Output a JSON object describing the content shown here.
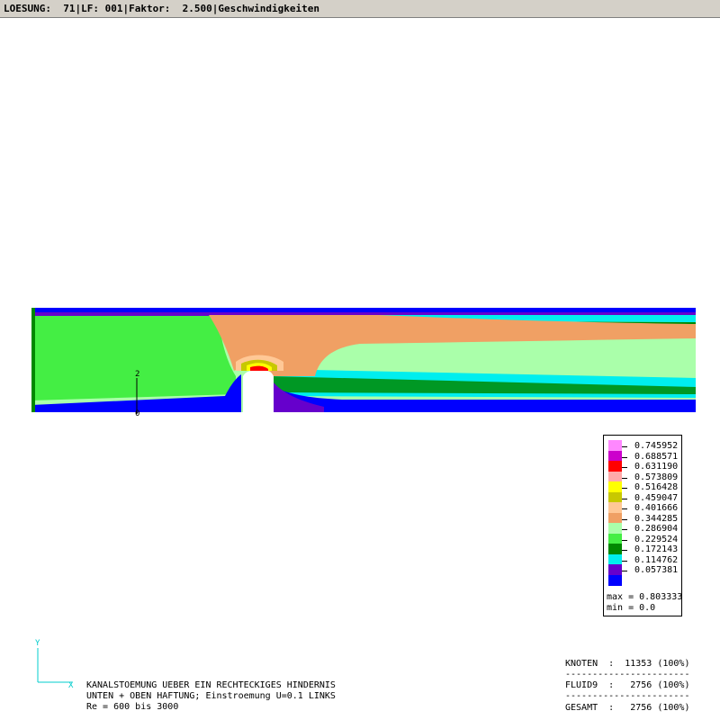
{
  "titlebar": {
    "text": "LOESUNG:  71|LF: 001|Faktor:  2.500|Geschwindigkeiten"
  },
  "legend": {
    "levels": [
      {
        "label": "0.745952",
        "color": "#ff88ff"
      },
      {
        "label": "0.688571",
        "color": "#cc00cc"
      },
      {
        "label": "0.631190",
        "color": "#ff0000"
      },
      {
        "label": "0.573809",
        "color": "#ffaaaa"
      },
      {
        "label": "0.516428",
        "color": "#ffff00"
      },
      {
        "label": "0.459047",
        "color": "#c8c800"
      },
      {
        "label": "0.401666",
        "color": "#ffc896"
      },
      {
        "label": "0.344285",
        "color": "#f0a064"
      },
      {
        "label": "0.286904",
        "color": "#aaffaa"
      },
      {
        "label": "0.229524",
        "color": "#44ee44"
      },
      {
        "label": "0.172143",
        "color": "#008800"
      },
      {
        "label": "0.114762",
        "color": "#00eeee"
      },
      {
        "label": "0.057381",
        "color": "#6600cc"
      },
      {
        "label": "",
        "color": "#0000ff"
      }
    ],
    "max_text": "max = 0.803333",
    "min_text": "min = 0.0"
  },
  "axis": {
    "y_letter": "Y",
    "x_letter": "X",
    "node_label_2": "2",
    "node_label_0": "0"
  },
  "caption": {
    "line1": "KANALSTOEMUNG UEBER EIN RECHTECKIGES HINDERNIS",
    "line2": "UNTEN + OBEN HAFTUNG; Einstroemung U=0.1 LINKS",
    "line3": "Re = 600 bis 3000"
  },
  "stats": {
    "knoten": "KNOTEN  :  11353 (100%)",
    "fluid9": "FLUID9  :   2756 (100%)",
    "gesamt": "GESAMT  :   2756 (100%)",
    "separator": "-----------------------"
  },
  "colors": {
    "background": "#ffffff",
    "titlebar": "#d4d0c8"
  }
}
